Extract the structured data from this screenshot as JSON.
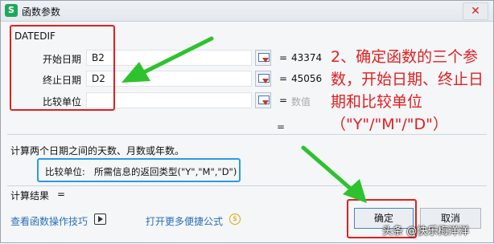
{
  "window": {
    "title": "函数参数",
    "app_icon": "S",
    "close_icon": "close-icon"
  },
  "function": {
    "name": "DATEDIF",
    "params": [
      {
        "label": "开始日期",
        "value": "B2",
        "result": "43374"
      },
      {
        "label": "终止日期",
        "value": "D2",
        "result": "45056"
      },
      {
        "label": "比较单位",
        "value": "",
        "result": "数值"
      }
    ],
    "result_eq": "="
  },
  "description": "计算两个日期之间的天数、月数或年数。",
  "param_help": {
    "label": "比较单位:",
    "text": "所需信息的返回类型(\"Y\",\"M\",\"D\")"
  },
  "calc_result": {
    "label": "计算结果",
    "value": "="
  },
  "links": {
    "tips": "查看函数操作技巧",
    "more": "打开更多便捷公式"
  },
  "buttons": {
    "ok": "确定",
    "cancel": "取消"
  },
  "annotation": {
    "text": "2、确定函数的三个参数，开始日期、终止日期和比较单位（\"Y\"/\"M\"/\"D\"）",
    "color": "#e02020"
  },
  "watermark": "头条 @快乐梅洋洋",
  "colors": {
    "annotation_red": "#e02020",
    "arrow_green": "#2ec22e",
    "help_blue": "#2b9ae6"
  }
}
